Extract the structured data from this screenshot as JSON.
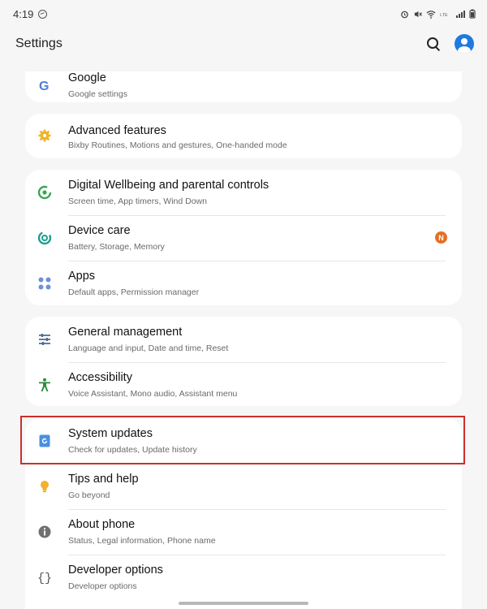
{
  "status_bar": {
    "time": "4:19"
  },
  "header": {
    "title": "Settings"
  },
  "cards": [
    {
      "items": [
        {
          "title": "Google",
          "subtitle": "Google settings",
          "icon": "google-icon"
        }
      ]
    },
    {
      "items": [
        {
          "title": "Advanced features",
          "subtitle": "Bixby Routines, Motions and gestures, One-handed mode",
          "icon": "gear-star-icon"
        }
      ]
    },
    {
      "items": [
        {
          "title": "Digital Wellbeing and parental controls",
          "subtitle": "Screen time, App timers, Wind Down",
          "icon": "wellbeing-icon"
        },
        {
          "title": "Device care",
          "subtitle": "Battery, Storage, Memory",
          "icon": "device-care-icon",
          "badge": "N"
        },
        {
          "title": "Apps",
          "subtitle": "Default apps, Permission manager",
          "icon": "apps-grid-icon"
        }
      ]
    },
    {
      "items": [
        {
          "title": "General management",
          "subtitle": "Language and input, Date and time, Reset",
          "icon": "sliders-icon"
        },
        {
          "title": "Accessibility",
          "subtitle": "Voice Assistant, Mono audio, Assistant menu",
          "icon": "accessibility-icon"
        }
      ]
    },
    {
      "items": [
        {
          "title": "System updates",
          "subtitle": "Check for updates, Update history",
          "icon": "system-update-icon"
        },
        {
          "title": "Tips and help",
          "subtitle": "Go beyond",
          "icon": "lightbulb-icon"
        },
        {
          "title": "About phone",
          "subtitle": "Status, Legal information, Phone name",
          "icon": "info-icon"
        },
        {
          "title": "Developer options",
          "subtitle": "Developer options",
          "icon": "braces-icon"
        }
      ]
    }
  ],
  "colors": {
    "accent_blue": "#1f7ae0",
    "highlight_border": "#c9302c",
    "badge": "#e36f26"
  }
}
